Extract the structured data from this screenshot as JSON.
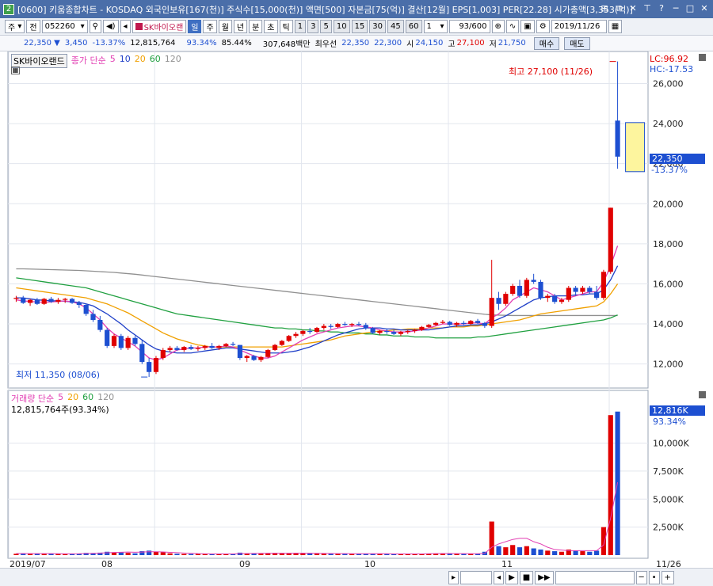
{
  "window": {
    "tag": "2",
    "title": "[0600] 키움종합차트 - KOSDAQ 외국인보유[167(천)] 주식수[15,000(천)] 액면[500] 자본금[75(억)] 결산[12월] EPS[1,003] PER[22.28] 시가총액[3,353(억)]",
    "buttons": [
      "⊞",
      "⧉",
      "✕",
      "⊤",
      "?",
      "─",
      "□",
      "✕"
    ]
  },
  "toolbar": {
    "period_type": "주",
    "prev_label": "전",
    "code": "052260",
    "stock_name": "SK바이오랜",
    "periods": [
      "일",
      "주",
      "월",
      "년",
      "분",
      "초",
      "틱"
    ],
    "selected_period": "일",
    "intervals": [
      "1",
      "3",
      "5",
      "10",
      "15",
      "30",
      "45",
      "60"
    ],
    "count_value": "1",
    "range_value": "93/600",
    "date_value": "2019/11/26"
  },
  "quote": {
    "price": "22,350 ▼",
    "change": "3,450",
    "change_pct": "-13.37%",
    "volume": "12,815,764",
    "vol_ratio": "93.34%",
    "turnover": "85.44%",
    "amount": "307,648백만",
    "best_label": "최우선",
    "ask": "22,350",
    "bid": "22,300",
    "open_label": "시",
    "open": "24,150",
    "high_label": "고",
    "high": "27,100",
    "low_label": "저",
    "low": "21,750",
    "buy_label": "매수",
    "sell_label": "매도"
  },
  "price_panel": {
    "name_label": "SK바이오랜드",
    "ma_label": "종가 단순",
    "ma_periods": [
      "5",
      "10",
      "20",
      "60",
      "120"
    ],
    "ma_colors": [
      "#e23fb3",
      "#2040c8",
      "#f0a000",
      "#20a040",
      "#909090"
    ],
    "lc": "LC:96.92",
    "hc": "HC:-17.53",
    "high_annotation": "최고 27,100 (11/26)",
    "low_annotation": "최저 11,350 (08/06)",
    "current_price": "22,350",
    "current_change": "-13.37%"
  },
  "volume_panel": {
    "title": "거래량 단순",
    "ma_periods": [
      "5",
      "20",
      "60",
      "120"
    ],
    "volume_text": "12,815,764주(93.34%)",
    "current_volume": "12,816K",
    "current_pct": "93.34%"
  },
  "x_axis": [
    "2019/07",
    "08",
    "09",
    "10",
    "11",
    "11/26"
  ],
  "chart_data": {
    "type": "candlestick",
    "price_axis": {
      "ticks": [
        "12,000",
        "14,000",
        "16,000",
        "18,000",
        "20,000",
        "22,000",
        "24,000",
        "26,000"
      ],
      "values": [
        12000,
        14000,
        16000,
        18000,
        20000,
        22000,
        24000,
        26000
      ],
      "ylim": [
        10800,
        27600
      ]
    },
    "volume_axis": {
      "ticks": [
        "2,500K",
        "5,000K",
        "7,500K",
        "10,000K"
      ],
      "values": [
        2500,
        5000,
        7500,
        10000
      ],
      "ylim": [
        0,
        14000
      ]
    },
    "candles": [
      [
        15250,
        15400,
        15100,
        15300,
        120
      ],
      [
        15300,
        15400,
        15000,
        15050,
        150
      ],
      [
        15050,
        15250,
        14900,
        15200,
        140
      ],
      [
        15200,
        15300,
        14950,
        15000,
        110
      ],
      [
        15000,
        15300,
        14950,
        15250,
        130
      ],
      [
        15250,
        15350,
        15050,
        15100,
        120
      ],
      [
        15100,
        15300,
        15000,
        15200,
        110
      ],
      [
        15200,
        15300,
        15050,
        15250,
        100
      ],
      [
        15250,
        15300,
        15000,
        15050,
        120
      ],
      [
        15050,
        15150,
        14800,
        14950,
        140
      ],
      [
        14950,
        15000,
        14400,
        14500,
        200
      ],
      [
        14500,
        14700,
        14100,
        14200,
        180
      ],
      [
        14200,
        14400,
        13600,
        13700,
        220
      ],
      [
        13700,
        13800,
        12800,
        12900,
        300
      ],
      [
        12900,
        13500,
        12800,
        13400,
        250
      ],
      [
        13400,
        13500,
        12700,
        12800,
        240
      ],
      [
        12800,
        13400,
        12700,
        13300,
        200
      ],
      [
        13300,
        13400,
        12900,
        13000,
        160
      ],
      [
        13000,
        13200,
        12000,
        12100,
        350
      ],
      [
        12100,
        12300,
        11350,
        11600,
        400
      ],
      [
        11600,
        12400,
        11500,
        12300,
        300
      ],
      [
        12300,
        12800,
        12200,
        12700,
        250
      ],
      [
        12700,
        12900,
        12600,
        12800,
        160
      ],
      [
        12800,
        12900,
        12650,
        12700,
        120
      ],
      [
        12700,
        12900,
        12600,
        12850,
        110
      ],
      [
        12850,
        12950,
        12700,
        12750,
        100
      ],
      [
        12750,
        12900,
        12650,
        12800,
        110
      ],
      [
        12800,
        12950,
        12700,
        12900,
        120
      ],
      [
        12900,
        13050,
        12750,
        12800,
        110
      ],
      [
        12800,
        12950,
        12700,
        12900,
        100
      ],
      [
        12900,
        13050,
        12850,
        13000,
        120
      ],
      [
        13000,
        13100,
        12900,
        12950,
        100
      ],
      [
        12950,
        12950,
        12200,
        12300,
        220
      ],
      [
        12300,
        12450,
        12100,
        12400,
        140
      ],
      [
        12400,
        12450,
        12150,
        12200,
        160
      ],
      [
        12200,
        12400,
        12100,
        12350,
        130
      ],
      [
        12350,
        12750,
        12300,
        12700,
        170
      ],
      [
        12700,
        13000,
        12650,
        12950,
        200
      ],
      [
        12950,
        13200,
        12900,
        13150,
        190
      ],
      [
        13150,
        13450,
        13100,
        13400,
        180
      ],
      [
        13400,
        13600,
        13300,
        13500,
        170
      ],
      [
        13500,
        13700,
        13400,
        13650,
        160
      ],
      [
        13650,
        13800,
        13500,
        13600,
        150
      ],
      [
        13600,
        13850,
        13550,
        13800,
        150
      ],
      [
        13800,
        14000,
        13700,
        13900,
        140
      ],
      [
        13900,
        14000,
        13750,
        13850,
        120
      ],
      [
        13850,
        14050,
        13800,
        14000,
        130
      ],
      [
        14000,
        14100,
        13900,
        13950,
        120
      ],
      [
        13950,
        14050,
        13850,
        14000,
        110
      ],
      [
        14000,
        14100,
        13900,
        13950,
        100
      ],
      [
        13950,
        14050,
        13700,
        13800,
        120
      ],
      [
        13800,
        13850,
        13500,
        13550,
        130
      ],
      [
        13550,
        13700,
        13450,
        13650,
        110
      ],
      [
        13650,
        13750,
        13500,
        13600,
        100
      ],
      [
        13600,
        13700,
        13450,
        13500,
        110
      ],
      [
        13500,
        13650,
        13400,
        13600,
        100
      ],
      [
        13600,
        13700,
        13500,
        13650,
        100
      ],
      [
        13650,
        13750,
        13550,
        13700,
        110
      ],
      [
        13700,
        13900,
        13650,
        13850,
        130
      ],
      [
        13850,
        14000,
        13800,
        13950,
        140
      ],
      [
        13950,
        14100,
        13900,
        14050,
        150
      ],
      [
        14050,
        14200,
        14000,
        14100,
        150
      ],
      [
        14100,
        14150,
        13900,
        13950,
        120
      ],
      [
        13950,
        14100,
        13850,
        14050,
        110
      ],
      [
        14050,
        14150,
        13950,
        14000,
        100
      ],
      [
        14000,
        14200,
        13950,
        14150,
        130
      ],
      [
        14150,
        14250,
        14000,
        14050,
        120
      ],
      [
        14050,
        14100,
        13800,
        13900,
        300
      ],
      [
        13900,
        17200,
        13800,
        15300,
        3000
      ],
      [
        15300,
        15600,
        14700,
        15000,
        800
      ],
      [
        15000,
        15600,
        14900,
        15500,
        700
      ],
      [
        15500,
        16000,
        15400,
        15900,
        900
      ],
      [
        15900,
        16200,
        15300,
        15400,
        700
      ],
      [
        15400,
        16300,
        15300,
        16200,
        800
      ],
      [
        16200,
        16500,
        16000,
        16100,
        600
      ],
      [
        16100,
        16200,
        15200,
        15300,
        500
      ],
      [
        15300,
        15500,
        15100,
        15400,
        400
      ],
      [
        15400,
        15500,
        15000,
        15100,
        350
      ],
      [
        15100,
        15300,
        15000,
        15200,
        300
      ],
      [
        15200,
        15900,
        15100,
        15800,
        500
      ],
      [
        15800,
        15900,
        15400,
        15600,
        400
      ],
      [
        15600,
        15900,
        15500,
        15800,
        350
      ],
      [
        15800,
        15900,
        15500,
        15600,
        300
      ],
      [
        15600,
        15900,
        15200,
        15300,
        400
      ],
      [
        15300,
        16700,
        15200,
        16600,
        2500
      ],
      [
        16600,
        19800,
        16500,
        19800,
        12500
      ],
      [
        24150,
        27100,
        21750,
        22350,
        12816
      ]
    ],
    "ma5": [
      15200,
      15150,
      15120,
      15100,
      15080,
      15100,
      15120,
      15150,
      15100,
      15000,
      14800,
      14500,
      14200,
      13800,
      13500,
      13300,
      13100,
      12900,
      12600,
      12300,
      12200,
      12300,
      12500,
      12700,
      12750,
      12800,
      12800,
      12850,
      12850,
      12850,
      12900,
      12850,
      12700,
      12550,
      12400,
      12300,
      12300,
      12400,
      12600,
      12800,
      13000,
      13200,
      13350,
      13500,
      13600,
      13700,
      13800,
      13850,
      13900,
      13900,
      13850,
      13800,
      13700,
      13650,
      13600,
      13600,
      13600,
      13650,
      13700,
      13800,
      13900,
      14000,
      14000,
      14000,
      14000,
      14050,
      14050,
      14000,
      14300,
      14500,
      14800,
      15200,
      15400,
      15600,
      15800,
      15700,
      15600,
      15400,
      15200,
      15300,
      15400,
      15500,
      15600,
      15600,
      16100,
      16900,
      17900
    ],
    "ma10": [
      15300,
      15300,
      15250,
      15200,
      15180,
      15150,
      15150,
      15130,
      15100,
      15080,
      15000,
      14900,
      14700,
      14500,
      14250,
      14000,
      13700,
      13450,
      13200,
      12950,
      12750,
      12650,
      12600,
      12550,
      12550,
      12550,
      12600,
      12650,
      12700,
      12750,
      12800,
      12800,
      12750,
      12700,
      12650,
      12600,
      12550,
      12550,
      12550,
      12600,
      12650,
      12750,
      12850,
      13000,
      13150,
      13300,
      13450,
      13550,
      13650,
      13750,
      13800,
      13800,
      13800,
      13750,
      13750,
      13700,
      13700,
      13700,
      13700,
      13700,
      13750,
      13800,
      13850,
      13900,
      13900,
      13950,
      13950,
      14000,
      14100,
      14250,
      14400,
      14600,
      14800,
      15000,
      15200,
      15300,
      15350,
      15400,
      15400,
      15400,
      15450,
      15450,
      15500,
      15500,
      15700,
      16200,
      16900
    ],
    "ma20": [
      15800,
      15750,
      15700,
      15650,
      15600,
      15550,
      15500,
      15450,
      15400,
      15350,
      15300,
      15200,
      15100,
      15000,
      14850,
      14700,
      14550,
      14350,
      14150,
      13950,
      13750,
      13550,
      13400,
      13250,
      13150,
      13050,
      12950,
      12900,
      12850,
      12850,
      12850,
      12850,
      12850,
      12850,
      12850,
      12850,
      12850,
      12850,
      12850,
      12900,
      12950,
      13000,
      13050,
      13100,
      13150,
      13200,
      13300,
      13400,
      13450,
      13500,
      13550,
      13600,
      13650,
      13650,
      13700,
      13700,
      13750,
      13750,
      13750,
      13800,
      13800,
      13800,
      13850,
      13850,
      13850,
      13900,
      13900,
      13950,
      14000,
      14050,
      14100,
      14150,
      14200,
      14300,
      14400,
      14500,
      14550,
      14600,
      14650,
      14700,
      14750,
      14800,
      14850,
      14900,
      15100,
      15500,
      16000
    ],
    "ma60": [
      16300,
      16250,
      16200,
      16150,
      16100,
      16050,
      16000,
      15950,
      15900,
      15850,
      15800,
      15700,
      15600,
      15500,
      15400,
      15300,
      15200,
      15100,
      15000,
      14900,
      14800,
      14700,
      14600,
      14500,
      14450,
      14400,
      14350,
      14300,
      14250,
      14200,
      14150,
      14100,
      14050,
      14000,
      13950,
      13900,
      13850,
      13800,
      13800,
      13750,
      13750,
      13700,
      13700,
      13650,
      13650,
      13600,
      13600,
      13550,
      13550,
      13550,
      13500,
      13500,
      13450,
      13450,
      13400,
      13400,
      13400,
      13350,
      13350,
      13350,
      13300,
      13300,
      13300,
      13300,
      13300,
      13300,
      13350,
      13350,
      13400,
      13450,
      13500,
      13550,
      13600,
      13650,
      13700,
      13750,
      13800,
      13850,
      13900,
      13950,
      14000,
      14050,
      14100,
      14150,
      14200,
      14300,
      14450
    ],
    "ma120": [
      16750,
      16750,
      16740,
      16730,
      16720,
      16710,
      16700,
      16690,
      16680,
      16670,
      16650,
      16630,
      16610,
      16590,
      16570,
      16540,
      16510,
      16480,
      16440,
      16400,
      16360,
      16320,
      16280,
      16240,
      16200,
      16160,
      16120,
      16080,
      16040,
      16000,
      15960,
      15920,
      15880,
      15840,
      15800,
      15760,
      15720,
      15680,
      15640,
      15600,
      15560,
      15520,
      15480,
      15440,
      15400,
      15360,
      15320,
      15280,
      15240,
      15200,
      15160,
      15120,
      15080,
      15040,
      15000,
      14960,
      14920,
      14880,
      14840,
      14800,
      14760,
      14720,
      14680,
      14640,
      14600,
      14560,
      14520,
      14480,
      14450,
      14440,
      14430,
      14420,
      14420,
      14420,
      14420,
      14420,
      14420,
      14420,
      14420,
      14420,
      14420,
      14420,
      14420,
      14420,
      14420,
      14420,
      14420
    ],
    "vol_ma5": [
      140,
      140,
      135,
      130,
      130,
      130,
      120,
      115,
      115,
      120,
      140,
      160,
      180,
      210,
      240,
      260,
      270,
      260,
      270,
      300,
      300,
      280,
      250,
      220,
      190,
      160,
      130,
      115,
      110,
      110,
      110,
      110,
      130,
      140,
      150,
      160,
      170,
      170,
      170,
      170,
      180,
      180,
      170,
      160,
      150,
      140,
      130,
      130,
      120,
      120,
      120,
      120,
      120,
      120,
      110,
      110,
      110,
      110,
      110,
      120,
      130,
      140,
      140,
      130,
      130,
      120,
      120,
      150,
      700,
      1000,
      1200,
      1400,
      1500,
      1500,
      1200,
      1000,
      700,
      500,
      450,
      400,
      400,
      400,
      400,
      400,
      900,
      3300,
      6500
    ]
  }
}
